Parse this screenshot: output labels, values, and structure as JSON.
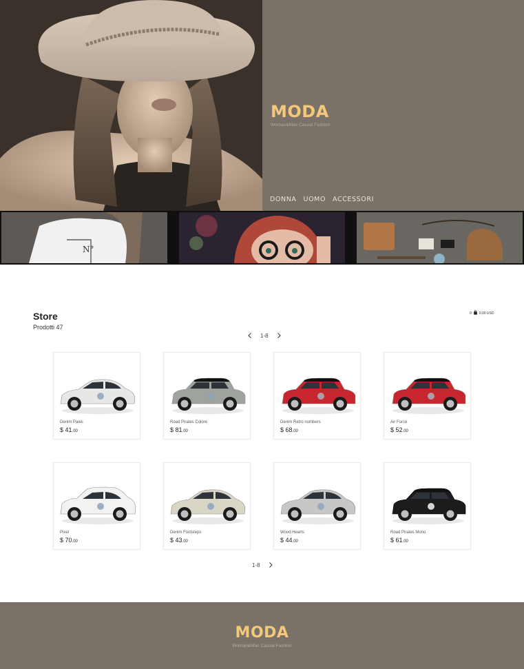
{
  "brand": {
    "logo": "MODA",
    "tagline": "Woman&Man Casual Fashion",
    "color": "#f3c87a"
  },
  "nav": {
    "items": [
      "DONNA",
      "UOMO",
      "ACCESSORI"
    ]
  },
  "store": {
    "title": "Store",
    "count": "Prodotti 47",
    "cart": {
      "count": "0",
      "total": "0,00 USD"
    },
    "pager_top": "1-8",
    "pager_bottom": "1-8"
  },
  "products": [
    {
      "name": "Denim Paws",
      "price_symbol": "$",
      "price_int": "41",
      "price_dec": ".00",
      "car_color": "#e7e7e7",
      "car_style": "hatch"
    },
    {
      "name": "Road Pirates Colore",
      "price_symbol": "$",
      "price_int": "81",
      "price_dec": ".00",
      "car_color": "#9ea39d",
      "car_style": "mini"
    },
    {
      "name": "Denim Retro numbers",
      "price_symbol": "$",
      "price_int": "68",
      "price_dec": ".00",
      "car_color": "#c8262e",
      "car_style": "mini"
    },
    {
      "name": "Air Force",
      "price_symbol": "$",
      "price_int": "52",
      "price_dec": ".00",
      "car_color": "#c8262e",
      "car_style": "mini"
    },
    {
      "name": "Pixel",
      "price_symbol": "$",
      "price_int": "70",
      "price_dec": ".00",
      "car_color": "#f2f2f2",
      "car_style": "suv"
    },
    {
      "name": "Denim Footsteps",
      "price_symbol": "$",
      "price_int": "43",
      "price_dec": ".00",
      "car_color": "#d9d6c6",
      "car_style": "hatch"
    },
    {
      "name": "Wood Hearts",
      "price_symbol": "$",
      "price_int": "44",
      "price_dec": ".00",
      "car_color": "#c7c7c7",
      "car_style": "hatch"
    },
    {
      "name": "Road Pirates Mono",
      "price_symbol": "$",
      "price_int": "61",
      "price_dec": ".00",
      "car_color": "#1c1c1c",
      "car_style": "mini"
    }
  ]
}
